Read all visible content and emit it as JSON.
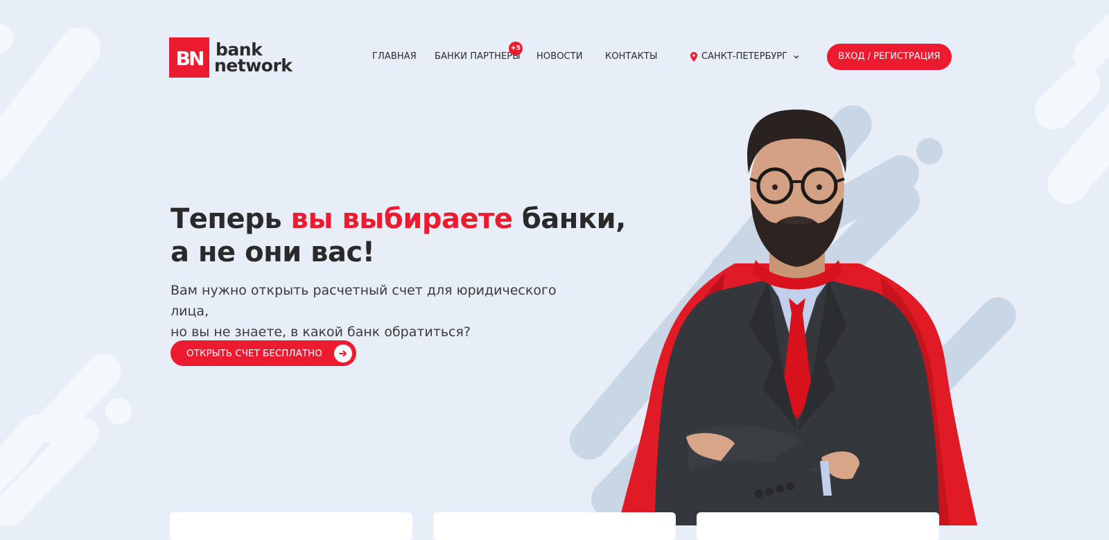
{
  "logo": {
    "mark_text": "BN",
    "word_line1": "bank",
    "word_line2": "network"
  },
  "nav": {
    "items": [
      {
        "label": "ГЛАВНАЯ"
      },
      {
        "label": "БАНКИ ПАРТНЕРЫ"
      },
      {
        "label": "НОВОСТИ"
      },
      {
        "label": "КОНТАКТЫ"
      }
    ],
    "partners_badge": "+5"
  },
  "city": {
    "label": "САНКТ-ПЕТЕРБУРГ",
    "icon": "location-pin-icon"
  },
  "login": {
    "label": "ВХОД / РЕГИСТРАЦИЯ"
  },
  "hero": {
    "title_part1": "Теперь ",
    "title_accent": "вы выбираете",
    "title_part2": " банки,",
    "title_line2": "а не они вас!",
    "subtitle_line1": "Вам нужно открыть расчетный счет для юридического лица,",
    "subtitle_line2": "но вы не знаете, в какой банк обратиться?",
    "cta_label": "ОТКРЫТЬ СЧЕТ БЕСПЛАТНО",
    "cta_icon": "arrow-right-icon"
  },
  "colors": {
    "accent": "#ed1b2f",
    "background": "#e7eef7",
    "text": "#2a2a2a",
    "shape_dark": "#c9d6e5",
    "shape_light": "#f4f8fc"
  }
}
